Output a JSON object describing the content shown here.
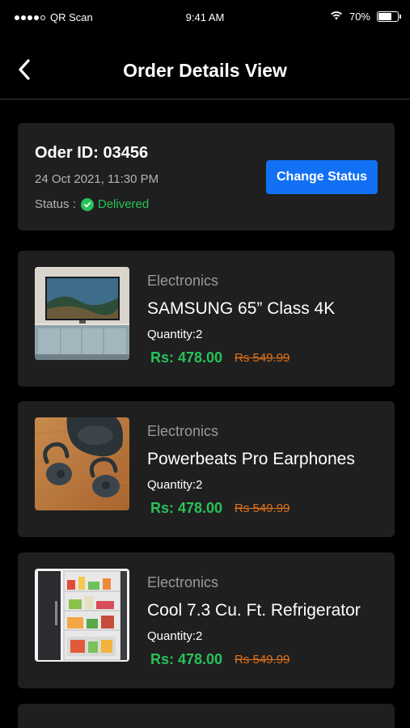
{
  "status_bar": {
    "carrier": "QR Scan",
    "time": "9:41 AM",
    "battery_percent": "70%",
    "battery_level": 0.7
  },
  "header": {
    "title": "Order Details View"
  },
  "order": {
    "id_label": "Oder ID: 03456",
    "date": "24 Oct 2021, 11:30 PM",
    "status_label": "Status :",
    "status_value": "Delivered",
    "change_status_label": "Change Status"
  },
  "products": [
    {
      "category": "Electronics",
      "name": "SAMSUNG 65” Class 4K",
      "quantity": "Quantity:2",
      "price": "Rs: 478.00",
      "old_price": "Rs 549.99",
      "image_icon": "tv-image"
    },
    {
      "category": "Electronics",
      "name": "Powerbeats Pro Earphones",
      "quantity": "Quantity:2",
      "price": "Rs: 478.00",
      "old_price": "Rs 549.99",
      "image_icon": "earphones-image"
    },
    {
      "category": "Electronics",
      "name": "Cool 7.3 Cu. Ft. Refrigerator",
      "quantity": "Quantity:2",
      "price": "Rs: 478.00",
      "old_price": "Rs 549.99",
      "image_icon": "refrigerator-image"
    }
  ],
  "colors": {
    "background": "#000000",
    "card": "#1f1f1f",
    "accent": "#1270f5",
    "success": "#27c25a",
    "strike_price": "#e0721a"
  }
}
